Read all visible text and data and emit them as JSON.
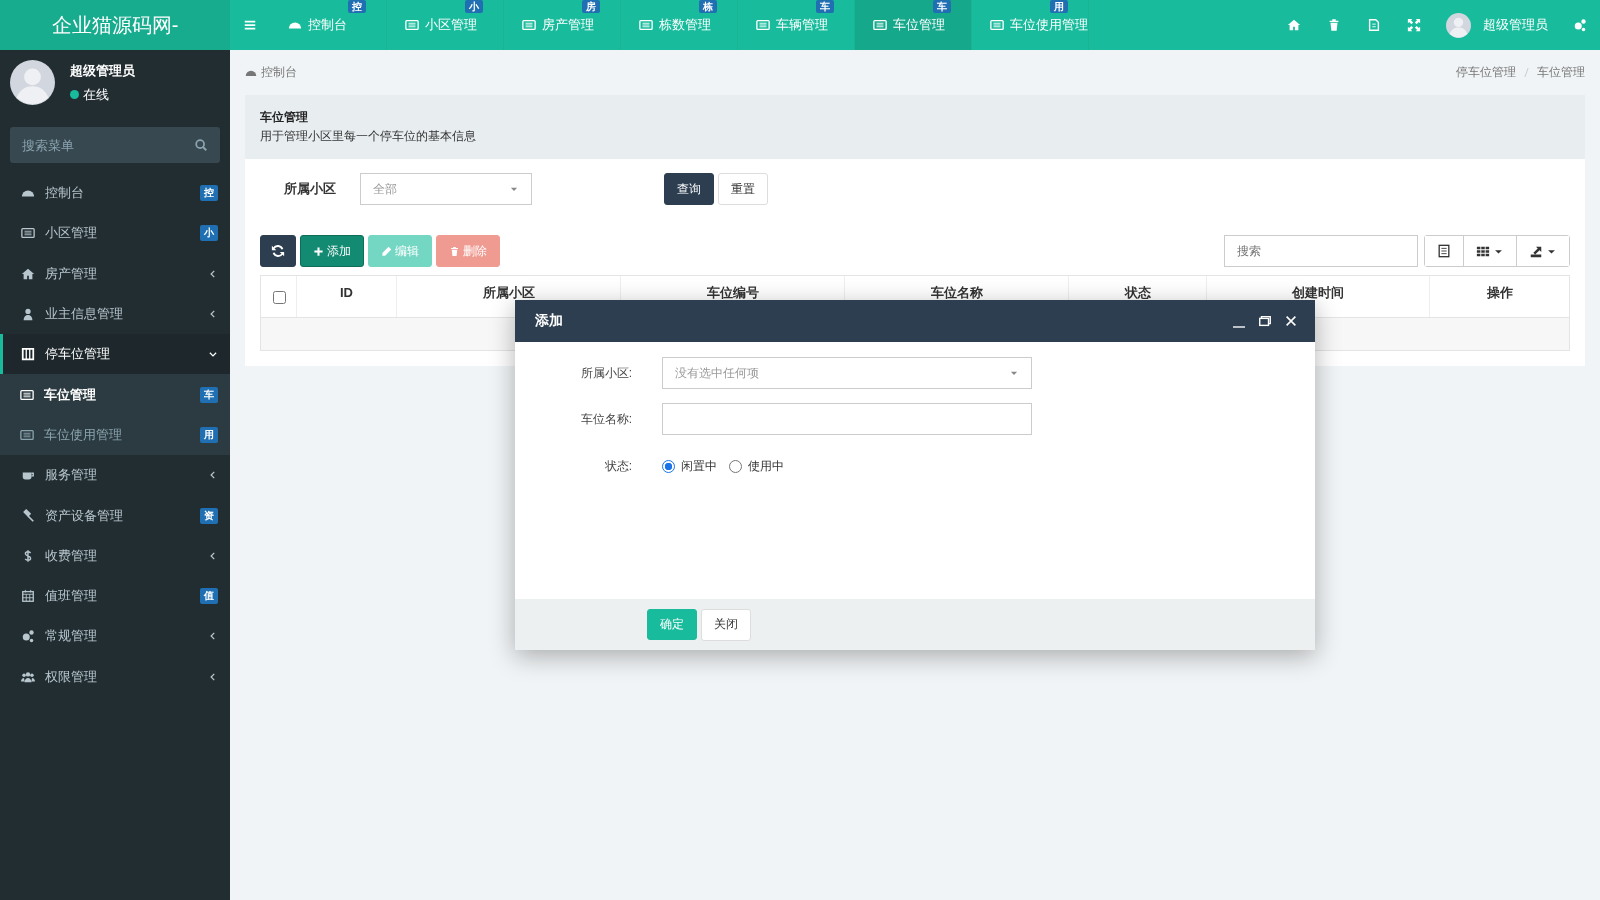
{
  "brand": "企业猫源码网-",
  "top_tabs": [
    {
      "label": "控制台",
      "badge": "控",
      "selected": false
    },
    {
      "label": "小区管理",
      "badge": "小",
      "selected": false
    },
    {
      "label": "房产管理",
      "badge": "房",
      "selected": false
    },
    {
      "label": "栋数管理",
      "badge": "栋",
      "selected": false
    },
    {
      "label": "车辆管理",
      "badge": "车",
      "selected": false
    },
    {
      "label": "车位管理",
      "badge": "车",
      "selected": true
    },
    {
      "label": "车位使用管理",
      "badge": "用",
      "selected": false
    }
  ],
  "top_user": "超级管理员",
  "sidebar": {
    "user": {
      "name": "超级管理员",
      "status": "在线"
    },
    "search": {
      "placeholder": "搜索菜单"
    },
    "items": [
      {
        "label": "控制台",
        "badge": "控",
        "selected": false
      },
      {
        "label": "小区管理",
        "badge": "小",
        "selected": false
      },
      {
        "label": "房产管理",
        "expanded": false,
        "selected": false
      },
      {
        "label": "业主信息管理",
        "expanded": false,
        "selected": false
      },
      {
        "label": "停车位管理",
        "expanded": true,
        "selected": true,
        "children": [
          {
            "label": "车位管理",
            "badge": "车",
            "selected": true
          },
          {
            "label": "车位使用管理",
            "badge": "用",
            "selected": false
          }
        ]
      },
      {
        "label": "服务管理",
        "expanded": false,
        "selected": false
      },
      {
        "label": "资产设备管理",
        "badge": "资",
        "selected": false
      },
      {
        "label": "收费管理",
        "expanded": false,
        "selected": false
      },
      {
        "label": "值班管理",
        "badge": "值",
        "selected": false
      },
      {
        "label": "常规管理",
        "expanded": false,
        "selected": false
      },
      {
        "label": "权限管理",
        "expanded": false,
        "selected": false
      }
    ]
  },
  "breadcrumb": {
    "home": "控制台",
    "path": [
      "停车位管理",
      "车位管理"
    ]
  },
  "panel": {
    "title": "车位管理",
    "description": "用于管理小区里每一个停车位的基本信息"
  },
  "filter": {
    "label": "所属小区",
    "value": "全部",
    "buttons": [
      "查询",
      "重置"
    ]
  },
  "toolbar": {
    "buttons": [
      {
        "label": "添加",
        "disabled": false
      },
      {
        "label": "编辑",
        "disabled": true
      },
      {
        "label": "删除",
        "disabled": true
      }
    ],
    "search": {
      "placeholder": "搜索"
    }
  },
  "table": {
    "checked": false,
    "columns": [
      "ID",
      "所属小区",
      "车位编号",
      "车位名称",
      "状态",
      "创建时间",
      "操作"
    ]
  },
  "modal": {
    "title": "添加",
    "fields": [
      {
        "kind": "select",
        "label": "所属小区:",
        "placeholder": "没有选中任何项"
      },
      {
        "kind": "text",
        "label": "车位名称:"
      },
      {
        "kind": "radio",
        "label": "状态:",
        "options": [
          {
            "label": "闲置中",
            "selected": true
          },
          {
            "label": "使用中",
            "selected": false
          }
        ]
      }
    ],
    "buttons": [
      "确定",
      "关闭"
    ]
  }
}
